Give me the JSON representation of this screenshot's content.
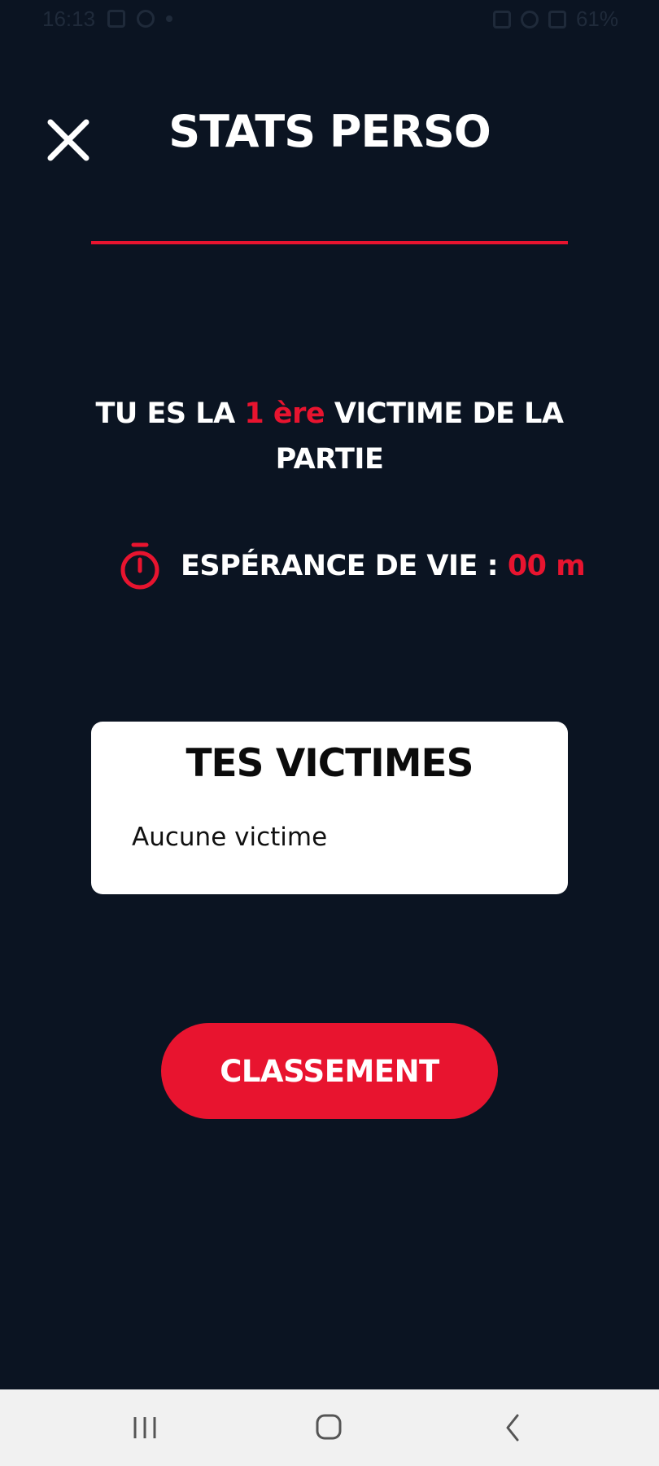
{
  "status_bar": {
    "time": "16:13",
    "battery": "61%"
  },
  "header": {
    "title": "STATS PERSO",
    "close_icon": "close-icon"
  },
  "rank": {
    "prefix": "TU ES LA ",
    "rank_value": "1 ère",
    "suffix": " VICTIME DE LA PARTIE"
  },
  "life_expectancy": {
    "icon": "stopwatch-icon",
    "label": "ESPÉRANCE DE VIE : ",
    "value": "00 m"
  },
  "victims": {
    "title": "TES VICTIMES",
    "empty_text": "Aucune victime"
  },
  "ranking_button": {
    "label": "CLASSEMENT"
  },
  "nav_bar": {
    "recent_icon": "recent-apps-icon",
    "home_icon": "home-icon",
    "back_icon": "back-icon"
  },
  "colors": {
    "background": "#0b1422",
    "accent": "#e8142f",
    "card": "#ffffff",
    "text": "#ffffff"
  }
}
